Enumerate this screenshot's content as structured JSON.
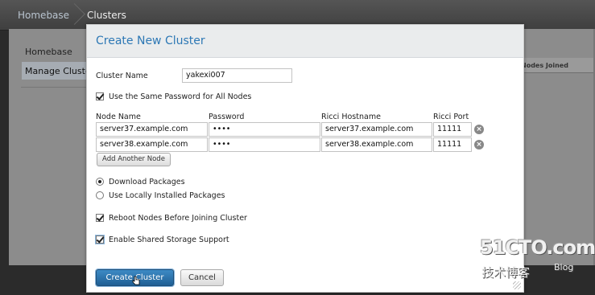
{
  "breadcrumb": {
    "home": "Homebase",
    "current": "Clusters"
  },
  "background": {
    "sidebar": {
      "homebase": "Homebase",
      "manage": "Manage Clusters"
    },
    "column_header": "Nodes Joined"
  },
  "dialog": {
    "title": "Create New Cluster",
    "cluster_name_label": "Cluster Name",
    "cluster_name_value": "yakexi007",
    "same_password_label": "Use the Same Password for All Nodes",
    "columns": {
      "node_name": "Node Name",
      "password": "Password",
      "ricci_hostname": "Ricci Hostname",
      "ricci_port": "Ricci Port"
    },
    "nodes": [
      {
        "node_name": "server37.example.com",
        "password": "••••",
        "ricci_hostname": "server37.example.com",
        "ricci_port": "11111"
      },
      {
        "node_name": "server38.example.com",
        "password": "••••",
        "ricci_hostname": "server38.example.com",
        "ricci_port": "11111"
      }
    ],
    "add_node_label": "Add Another Node",
    "download_packages_label": "Download Packages",
    "local_packages_label": "Use Locally Installed Packages",
    "reboot_label": "Reboot Nodes Before Joining Cluster",
    "shared_storage_label": "Enable Shared Storage Support",
    "create_label": "Create Cluster",
    "cancel_label": "Cancel",
    "remove_glyph": "×"
  },
  "watermark": {
    "main": "51CTO.com",
    "sub": "技术博客",
    "blog": "Blog"
  },
  "icons": {
    "remove": "remove-node-icon",
    "checkbox": "checkbox-icon",
    "radio": "radio-icon",
    "cursor": "hand-cursor-icon"
  },
  "colors": {
    "accent": "#2d78b5",
    "primary_button": "#1f5f94"
  }
}
